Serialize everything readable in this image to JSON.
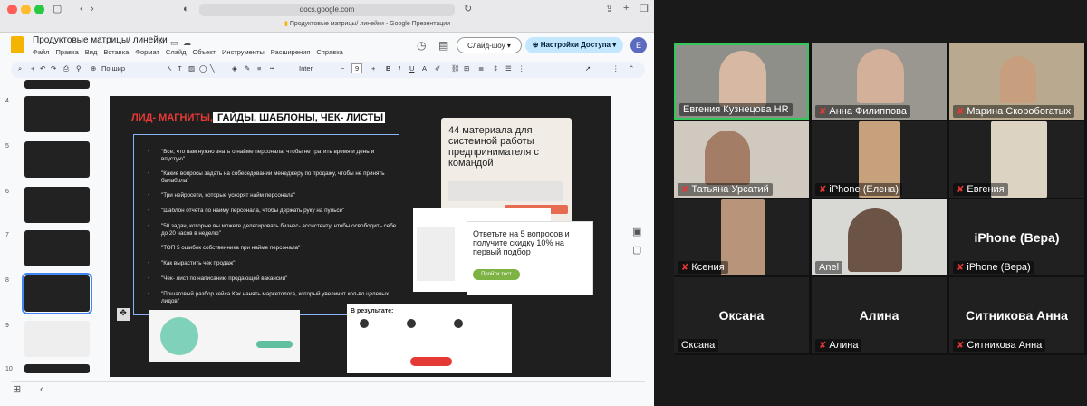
{
  "browser": {
    "url": "docs.google.com",
    "tab_title": "Продуктовые матрицы/ линейки - Google Презентации"
  },
  "doc": {
    "title": "Продуктовые матрицы/ линейки",
    "menu": [
      "Файл",
      "Правка",
      "Вид",
      "Вставка",
      "Формат",
      "Слайд",
      "Объект",
      "Инструменты",
      "Расширения",
      "Справка"
    ],
    "slideshow": "Слайд-шоу",
    "share": "Настройки Доступа",
    "avatar": "E"
  },
  "toolbar": {
    "zoom": "По шир",
    "font": "Inter",
    "size": "9"
  },
  "slides": [
    "4",
    "5",
    "6",
    "7",
    "8",
    "9",
    "10"
  ],
  "slide": {
    "title_red": "ЛИД- МАГНИТЫ,",
    "title_rest": " ГАЙДЫ, ШАБЛОНЫ, ЧЕК- ЛИСТЫ",
    "bullets": [
      "\"Все, что вам нужно знать о найме персонала, чтобы не тратить время и деньги впустую\"",
      "\"Какие вопросы задать на собеседовании менеджеру по продажу, чтобы не принять балабола\"",
      "\"Три нейросети, которые ускорят найм персонала\"",
      "\"Шаблон отчета по найму персонала, чтобы держать руку на пульсе\"",
      "\"50 задач, которые вы можете делегировать бизнес- ассистенту, чтобы освободить себе до 20 часов в неделю\"",
      "\"ТОП 5 ошибок собственника при найме персонала\"",
      "\"Как вырастить чек продаж\"",
      "\"Чек- лист по написанию продающей вакансии\"",
      "\"Пошаговый разбор кейса Как нанять маркетолога, который увеличит кол-во целевых лидов\""
    ],
    "card_title": "44 материала для системной работы предпринимателя с командой",
    "quiz": "Ответьте на 5 вопросов и получите скидку 10% на первый подбор",
    "quiz_btn": "Пройти тест",
    "result": "В результате:"
  },
  "meeting": {
    "participants": [
      {
        "name": "Евгения Кузнецова HR",
        "muted": false
      },
      {
        "name": "Анна Филиппова",
        "muted": true
      },
      {
        "name": "Марина Скоробогатых",
        "muted": true
      },
      {
        "name": "Татьяна Урсатий",
        "muted": true
      },
      {
        "name": "iPhone (Елена)",
        "muted": true
      },
      {
        "name": "Евгения",
        "muted": true
      },
      {
        "name": "Ксения",
        "muted": true
      },
      {
        "name": "Anel",
        "muted": false
      },
      {
        "name": "iPhone (Вера)",
        "muted": true
      },
      {
        "name": "Оксана",
        "muted": false
      },
      {
        "name": "Алина",
        "muted": true
      },
      {
        "name": "Ситникова Анна",
        "muted": true
      }
    ],
    "big_names": {
      "vera": "iPhone (Вера)",
      "oksana": "Оксана",
      "alina": "Алина",
      "sitnikova": "Ситникова Анна"
    }
  }
}
